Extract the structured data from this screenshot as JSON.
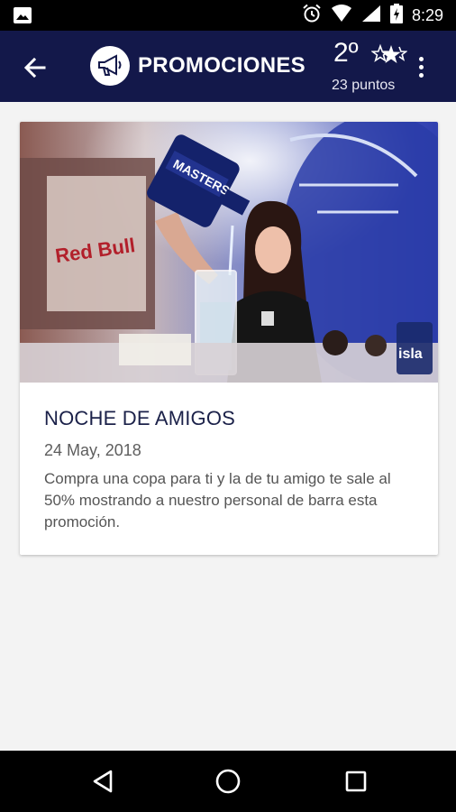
{
  "status_bar": {
    "time": "8:29",
    "icons": [
      "image-icon",
      "alarm-icon",
      "wifi-icon",
      "signal-icon",
      "battery-icon"
    ]
  },
  "app_bar": {
    "title": "PROMOCIONES",
    "rank_number": "2º",
    "points_text": "23 puntos",
    "colors": {
      "background": "#13184a",
      "title": "#ffffff"
    }
  },
  "promo": {
    "title": "NOCHE DE AMIGOS",
    "date": "24 May, 2018",
    "description": "Compra una copa para ti y la de tu amigo te sale al 50% mostrando a nuestro personal de barra esta promoción.",
    "image_bottle_text": "MASTERS",
    "image_brand_text": "isla"
  },
  "nav_bar": {
    "icons": [
      "back-triangle-icon",
      "home-circle-icon",
      "recents-square-icon"
    ]
  }
}
